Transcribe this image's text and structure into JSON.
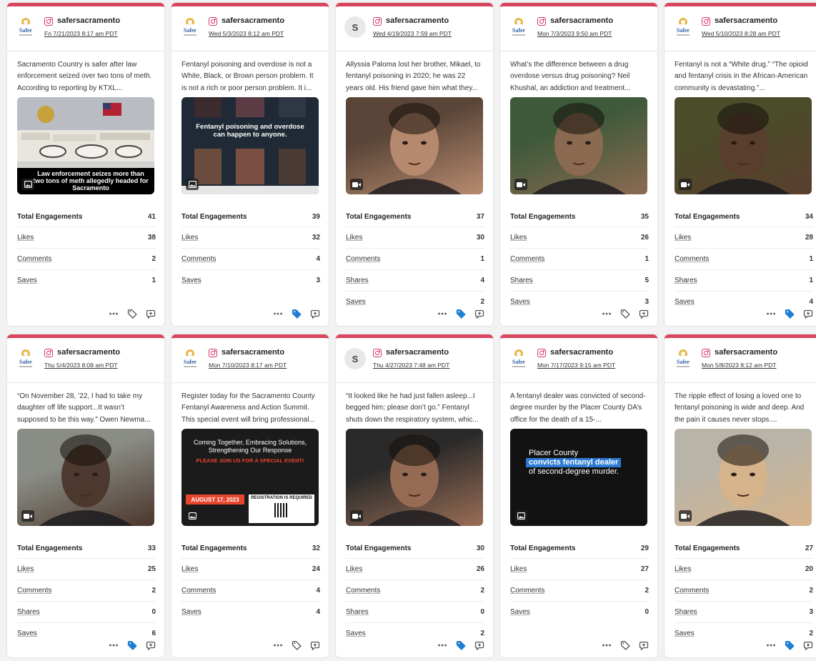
{
  "posts": [
    {
      "avatar": "logo",
      "handle": "safersacramento",
      "date": "Fri 7/21/2023 8:17 am PDT",
      "text": "Sacramento Country is safer after law enforcement seized over two tons of meth. According to reporting by KTXL...",
      "media_type": "image",
      "media_overlay": "Law enforcement seizes more than two tons of meth allegedly headed for Sacramento",
      "media_scene": "seizure",
      "media_colors": [
        "#b9bcc2",
        "#ece9e2"
      ],
      "metrics": [
        {
          "label": "Total Engagements",
          "value": "41"
        },
        {
          "label": "Likes",
          "value": "38"
        },
        {
          "label": "Comments",
          "value": "2"
        },
        {
          "label": "Saves",
          "value": "1"
        }
      ],
      "tagged": false
    },
    {
      "avatar": "logo",
      "handle": "safersacramento",
      "date": "Wed 5/3/2023 8:12 am PDT",
      "text": "Fentanyl poisoning and overdose is not a White, Black, or Brown person problem. It is not a rich or poor person problem. It i...",
      "media_type": "image",
      "media_overlay": "Fentanyl poisoning and overdose can happen to anyone.",
      "media_scene": "collage",
      "media_colors": [
        "#26303a",
        "#5a3d45"
      ],
      "metrics": [
        {
          "label": "Total Engagements",
          "value": "39"
        },
        {
          "label": "Likes",
          "value": "32"
        },
        {
          "label": "Comments",
          "value": "4"
        },
        {
          "label": "Saves",
          "value": "3"
        }
      ],
      "tagged": true
    },
    {
      "avatar": "S",
      "handle": "safersacramento",
      "date": "Wed 4/19/2023 7:59 am PDT",
      "text": "Allyssia Paloma lost her brother, Mikael, to fentanyl poisoning in 2020; he was 22 years old. His friend gave him what they...",
      "media_type": "video",
      "media_overlay": "",
      "media_scene": "portrait",
      "media_colors": [
        "#5a4538",
        "#b88c70"
      ],
      "metrics": [
        {
          "label": "Total Engagements",
          "value": "37"
        },
        {
          "label": "Likes",
          "value": "30"
        },
        {
          "label": "Comments",
          "value": "1"
        },
        {
          "label": "Shares",
          "value": "4"
        },
        {
          "label": "Saves",
          "value": "2"
        }
      ],
      "tagged": true
    },
    {
      "avatar": "logo",
      "handle": "safersacramento",
      "date": "Mon 7/3/2023 9:50 am PDT",
      "text": "What’s the difference between a drug overdose versus drug poisoning? Neil Khushal, an addiction and treatment...",
      "media_type": "video",
      "media_overlay": "",
      "media_scene": "portrait",
      "media_colors": [
        "#3e5a3a",
        "#8d6a52"
      ],
      "metrics": [
        {
          "label": "Total Engagements",
          "value": "35"
        },
        {
          "label": "Likes",
          "value": "26"
        },
        {
          "label": "Comments",
          "value": "1"
        },
        {
          "label": "Shares",
          "value": "5"
        },
        {
          "label": "Saves",
          "value": "3"
        }
      ],
      "tagged": false
    },
    {
      "avatar": "logo",
      "handle": "safersacramento",
      "date": "Wed 5/10/2023 8:28 am PDT",
      "text": "Fentanyl is not a “White drug.” “The opioid and fentanyl crisis in the African-American community is devastating.”...",
      "media_type": "video",
      "media_overlay": "",
      "media_scene": "portrait",
      "media_colors": [
        "#4a4c2a",
        "#5a3e2e"
      ],
      "metrics": [
        {
          "label": "Total Engagements",
          "value": "34"
        },
        {
          "label": "Likes",
          "value": "28"
        },
        {
          "label": "Comments",
          "value": "1"
        },
        {
          "label": "Shares",
          "value": "1"
        },
        {
          "label": "Saves",
          "value": "4"
        }
      ],
      "tagged": true
    },
    {
      "avatar": "logo",
      "handle": "safersacramento",
      "date": "Thu 5/4/2023 8:08 am PDT",
      "text": "“On November 28, ’22, I had to take my daughter off life support...It wasn’t supposed to be this way.” Owen Newma...",
      "media_type": "video",
      "media_overlay": "",
      "media_scene": "portrait",
      "media_colors": [
        "#8a8d86",
        "#4b362b"
      ],
      "metrics": [
        {
          "label": "Total Engagements",
          "value": "33"
        },
        {
          "label": "Likes",
          "value": "25"
        },
        {
          "label": "Comments",
          "value": "2"
        },
        {
          "label": "Shares",
          "value": "0"
        },
        {
          "label": "Saves",
          "value": "6"
        }
      ],
      "tagged": true
    },
    {
      "avatar": "logo",
      "handle": "safersacramento",
      "date": "Mon 7/10/2023 8:17 am PDT",
      "text": "Register today for the Sacramento County Fentanyl Awareness and Action Summit. This special event will bring professional...",
      "media_type": "image",
      "media_overlay": "Coming Together, Embracing Solutions, Strengthening Our Response",
      "media_scene": "flyer",
      "media_colors": [
        "#1e1e1e",
        "#e8452c"
      ],
      "media_extra": {
        "event": "PLEASE JOIN US FOR A SPECIAL EVENT!",
        "event_date": "AUGUST 17, 2023",
        "registration": "REGISTRATION IS REQUIRED"
      },
      "metrics": [
        {
          "label": "Total Engagements",
          "value": "32"
        },
        {
          "label": "Likes",
          "value": "24"
        },
        {
          "label": "Comments",
          "value": "4"
        },
        {
          "label": "Saves",
          "value": "4"
        }
      ],
      "tagged": false
    },
    {
      "avatar": "S",
      "handle": "safersacramento",
      "date": "Thu 4/27/2023 7:48 am PDT",
      "text": "“It looked like he had just fallen asleep...I begged him; please don’t go.” Fentanyl shuts down the respiratory system, whic...",
      "media_type": "video",
      "media_overlay": "",
      "media_scene": "portrait",
      "media_colors": [
        "#2a2a2a",
        "#9a6e55"
      ],
      "metrics": [
        {
          "label": "Total Engagements",
          "value": "30"
        },
        {
          "label": "Likes",
          "value": "26"
        },
        {
          "label": "Comments",
          "value": "2"
        },
        {
          "label": "Shares",
          "value": "0"
        },
        {
          "label": "Saves",
          "value": "2"
        }
      ],
      "tagged": true
    },
    {
      "avatar": "logo",
      "handle": "safersacramento",
      "date": "Mon 7/17/2023 9:15 am PDT",
      "text": "A fentanyl dealer was convicted of second-degree murder by the Placer County DA’s office for the death of a 15-...",
      "media_type": "image",
      "media_overlay": "Placer County",
      "media_scene": "title",
      "media_colors": [
        "#121212",
        "#2e7bd6"
      ],
      "media_extra": {
        "highlight": "convicts fentanyl dealer",
        "tail": "of second-degree murder."
      },
      "metrics": [
        {
          "label": "Total Engagements",
          "value": "29"
        },
        {
          "label": "Likes",
          "value": "27"
        },
        {
          "label": "Comments",
          "value": "2"
        },
        {
          "label": "Saves",
          "value": "0"
        }
      ],
      "tagged": false
    },
    {
      "avatar": "logo",
      "handle": "safersacramento",
      "date": "Mon 5/8/2023 8:12 am PDT",
      "text": "The ripple effect of losing a loved one to fentanyl poisoning is wide and deep. And the pain it causes never stops....",
      "media_type": "video",
      "media_overlay": "",
      "media_scene": "portrait",
      "media_colors": [
        "#b9b4a8",
        "#d6b38a"
      ],
      "metrics": [
        {
          "label": "Total Engagements",
          "value": "27"
        },
        {
          "label": "Likes",
          "value": "20"
        },
        {
          "label": "Comments",
          "value": "2"
        },
        {
          "label": "Shares",
          "value": "3"
        },
        {
          "label": "Saves",
          "value": "2"
        }
      ],
      "tagged": true
    }
  ],
  "logo_text": "Safer",
  "colors": {
    "accent_bar": "#d9455f",
    "instagram": "#d6336c",
    "tag_active": "#1f7fd1",
    "icon_gray": "#555555"
  },
  "icons": [
    "instagram-icon",
    "image-icon",
    "video-icon",
    "more-icon",
    "tag-icon",
    "reply-icon"
  ]
}
